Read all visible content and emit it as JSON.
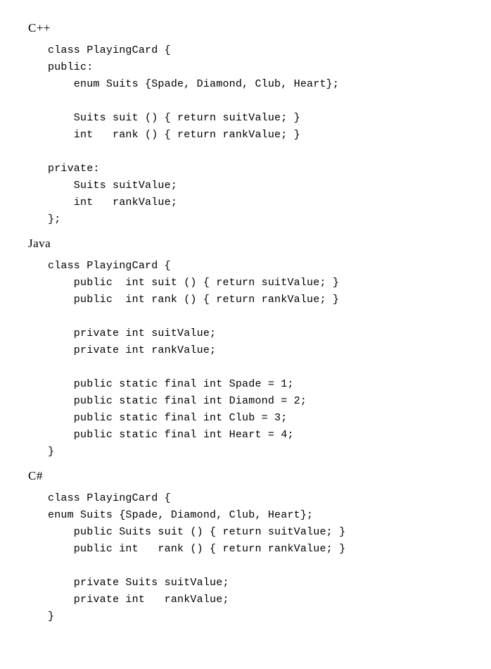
{
  "sections": [
    {
      "lang": "C++",
      "code": "class PlayingCard {\npublic:\n    enum Suits {Spade, Diamond, Club, Heart};\n\n    Suits suit () { return suitValue; }\n    int   rank () { return rankValue; }\n\nprivate:\n    Suits suitValue;\n    int   rankValue;\n};"
    },
    {
      "lang": "Java",
      "code": "class PlayingCard {\n    public  int suit () { return suitValue; }\n    public  int rank () { return rankValue; }\n\n    private int suitValue;\n    private int rankValue;\n\n    public static final int Spade = 1;\n    public static final int Diamond = 2;\n    public static final int Club = 3;\n    public static final int Heart = 4;\n}"
    },
    {
      "lang": "C#",
      "code": "class PlayingCard {\nenum Suits {Spade, Diamond, Club, Heart};\n    public Suits suit () { return suitValue; }\n    public int   rank () { return rankValue; }\n\n    private Suits suitValue;\n    private int   rankValue;\n}"
    }
  ]
}
